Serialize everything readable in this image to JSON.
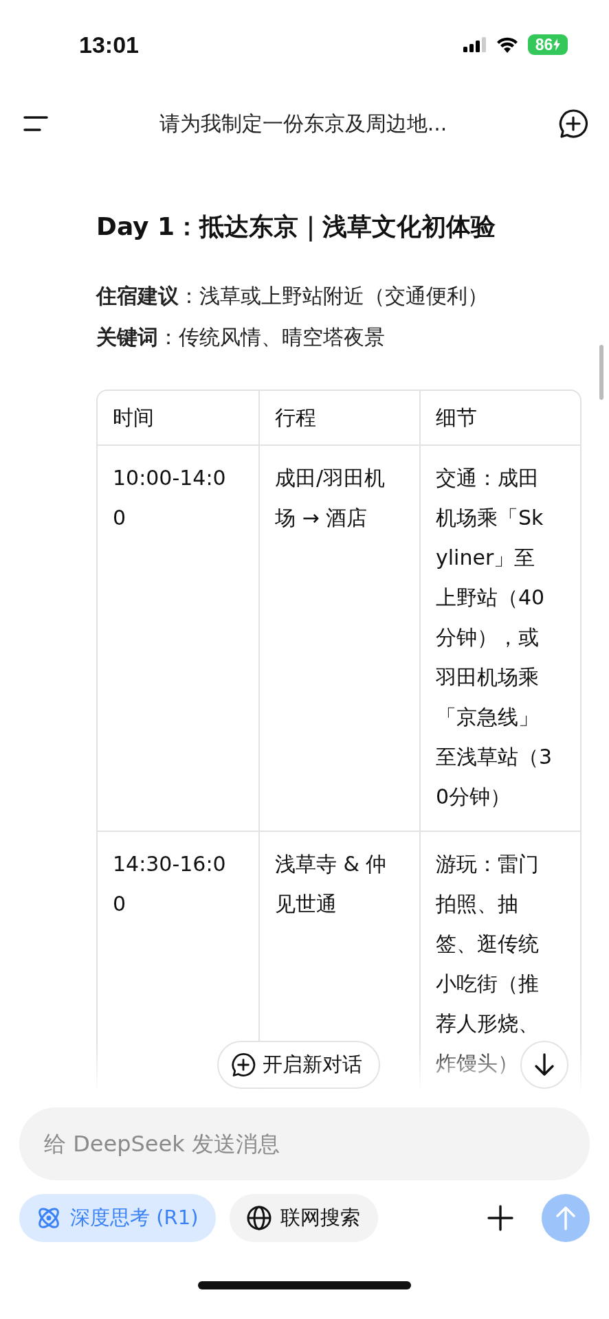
{
  "status_bar": {
    "time": "13:01",
    "battery": "86"
  },
  "header": {
    "title": "请为我制定一份东京及周边地..."
  },
  "message": {
    "heading": "Day 1：抵达东京｜浅草文化初体验",
    "lines": [
      "**住宿建议**：浅草或上野站附近（交通便利）",
      "**关键词**：传统风情、晴空塔夜景"
    ],
    "table": {
      "columns": [
        "时间",
        "行程",
        "细节"
      ],
      "rows": [
        [
          "10:00-14:00",
          "成田/羽田机场 → 酒店",
          "交通：成田机场乘「Skyliner」至上野站（40分钟），或羽田机场乘「京急线」至浅草站（30分钟）"
        ],
        [
          "14:30-16:00",
          "浅草寺 & 仲见世通",
          "游玩：雷门拍照、抽签、逛传统小吃街（推荐人形烧、炸馒头）"
        ]
      ]
    }
  },
  "new_chat_button": {
    "label": "开启新对话"
  },
  "composer": {
    "placeholder": "给 DeepSeek 发送消息",
    "toggles": [
      {
        "kind": "think",
        "label": "深度思考 (R1)",
        "selected": true
      },
      {
        "kind": "search",
        "label": "联网搜索",
        "selected": false
      }
    ],
    "send_disabled": true
  }
}
